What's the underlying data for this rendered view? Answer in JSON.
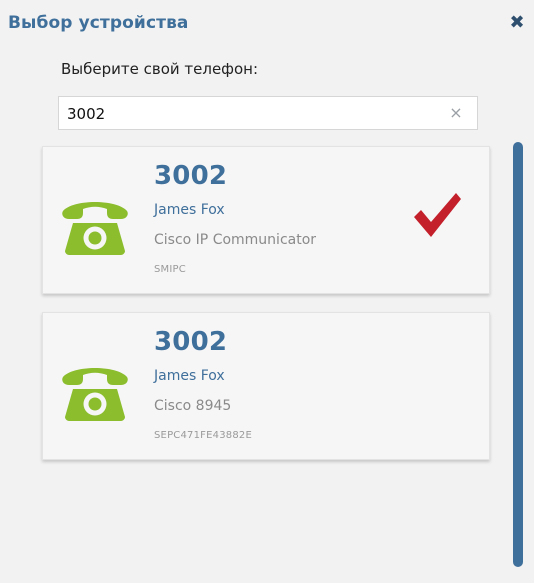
{
  "header": {
    "title": "Выбор устройства",
    "close_icon": "close-icon"
  },
  "search": {
    "prompt": "Выберите свой телефон:",
    "value": "3002",
    "clear_icon": "clear-icon"
  },
  "results": [
    {
      "number": "3002",
      "user": "James Fox",
      "model": "Cisco IP Communicator",
      "device": "SMIPC",
      "selected": true,
      "icon": "phone-icon"
    },
    {
      "number": "3002",
      "user": "James Fox",
      "model": "Cisco 8945",
      "device": "SEPC471FE43882E",
      "selected": false,
      "icon": "phone-icon"
    }
  ],
  "colors": {
    "accent": "#3f6f9b",
    "phone_green": "#8bbd2d",
    "check_red": "#c3202b",
    "panel_bg": "#f2f2f2"
  }
}
